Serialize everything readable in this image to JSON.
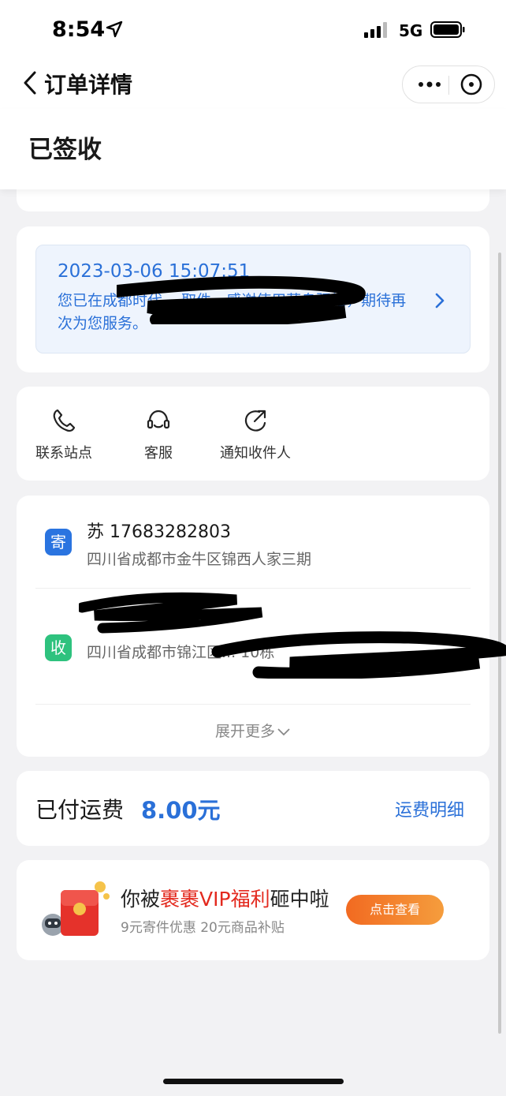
{
  "statusbar": {
    "time": "8:54",
    "network": "5G"
  },
  "navbar": {
    "title": "订单详情"
  },
  "order": {
    "status": "已签收"
  },
  "tracking": {
    "time": "2023-03-06 15:07:51",
    "text": "您已在成都时代... 取件，感谢使用菜鸟驿站，期待再次为您服务。"
  },
  "actions": [
    {
      "label": "联系站点",
      "icon": "phone-icon"
    },
    {
      "label": "客服",
      "icon": "headset-icon"
    },
    {
      "label": "通知收件人",
      "icon": "share-icon"
    }
  ],
  "sender": {
    "tag": "寄",
    "name": "苏 17683282803",
    "address": "四川省成都市金牛区锦西人家三期"
  },
  "receiver": {
    "tag": "收",
    "address": "四川省成都市锦江区... 10栋"
  },
  "expand_label": "展开更多",
  "fee": {
    "label": "已付运费",
    "amount": "8.00元",
    "detail": "运费明细"
  },
  "promo": {
    "title_pre": "你被",
    "title_highlight": "裹裹VIP福利",
    "title_post": "砸中啦",
    "subtitle": "9元寄件优惠 20元商品补贴",
    "button": "点击查看"
  },
  "colors": {
    "accent": "#2a70d8",
    "send_tag": "#2a74e0",
    "recv_tag": "#2ec27e",
    "promo_red": "#e32a1f",
    "promo_button": "#f26a21"
  }
}
